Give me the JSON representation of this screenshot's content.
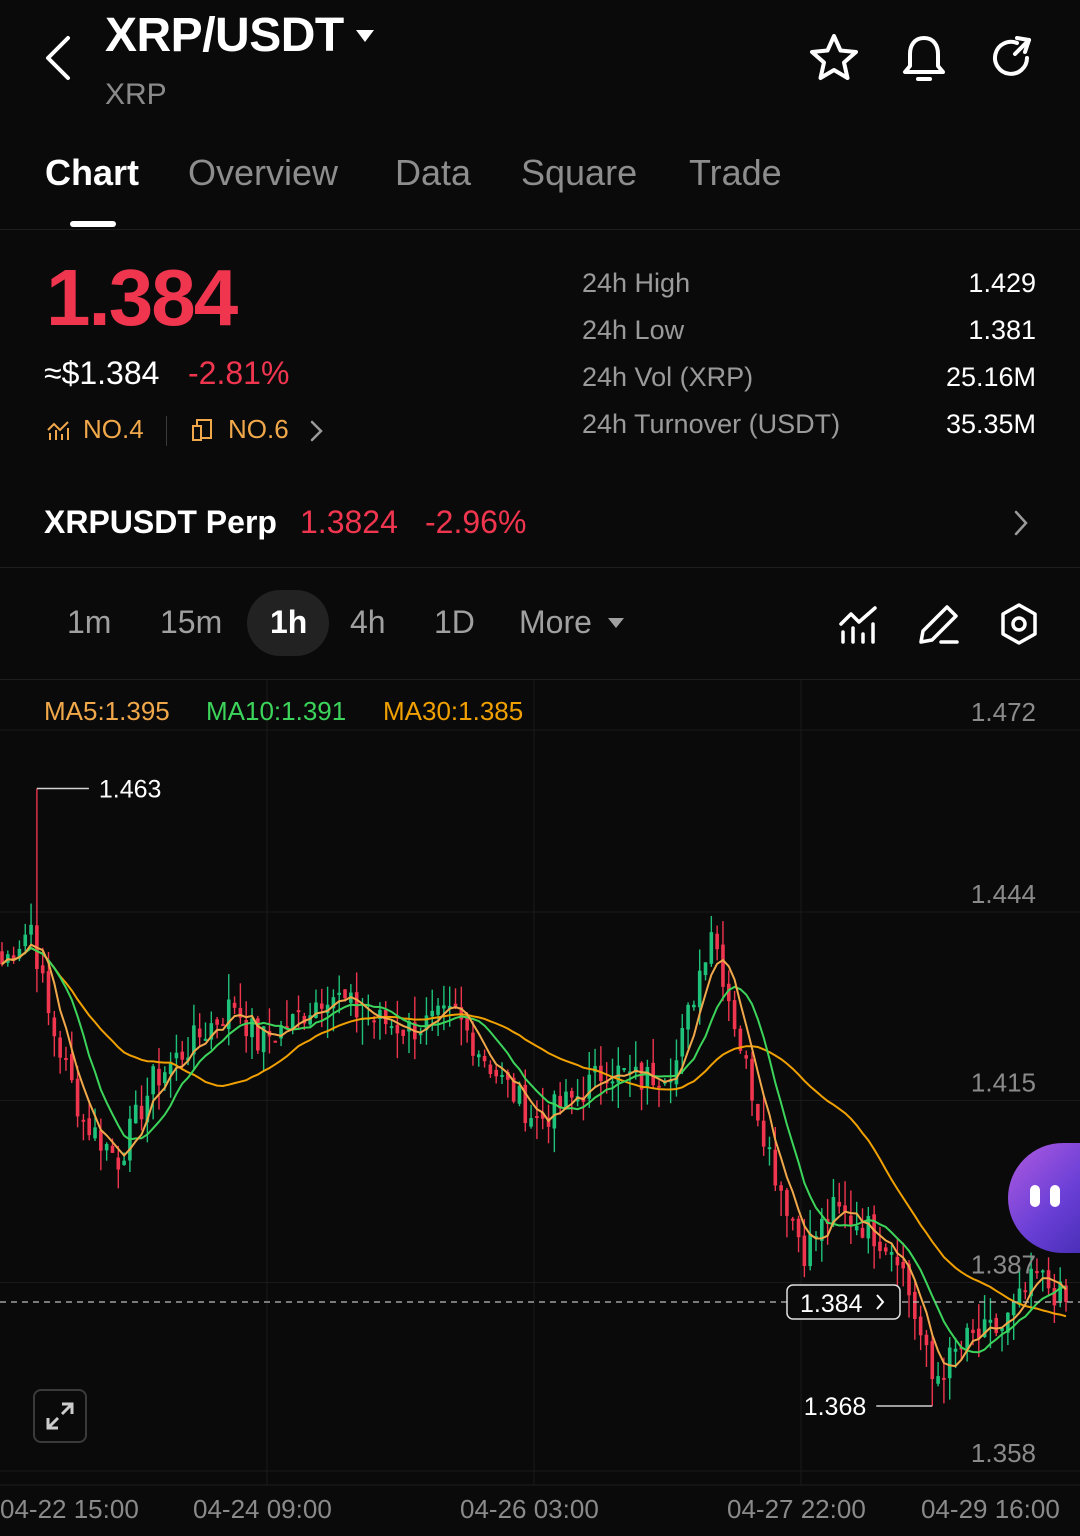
{
  "header": {
    "pair": "XRP/USDT",
    "base": "XRP",
    "icons": [
      "back-arrow-icon",
      "star-icon",
      "bell-icon",
      "share-icon"
    ]
  },
  "tabs": [
    {
      "label": "Chart",
      "active": true
    },
    {
      "label": "Overview",
      "active": false
    },
    {
      "label": "Data",
      "active": false
    },
    {
      "label": "Square",
      "active": false
    },
    {
      "label": "Trade",
      "active": false
    }
  ],
  "price": {
    "last": "1.384",
    "usd": "≈$1.384",
    "change_pct": "-2.81%",
    "rank1": "NO.4",
    "rank2": "NO.6"
  },
  "stats": [
    {
      "label": "24h  High",
      "value": "1.429"
    },
    {
      "label": "24h  Low",
      "value": "1.381"
    },
    {
      "label": "24h  Vol (XRP)",
      "value": "25.16M"
    },
    {
      "label": "24h  Turnover (USDT)",
      "value": "35.35M"
    }
  ],
  "perp": {
    "name": "XRPUSDT Perp",
    "price": "1.3824",
    "change_pct": "-2.96%"
  },
  "timeframes": [
    {
      "label": "1m",
      "active": false
    },
    {
      "label": "15m",
      "active": false
    },
    {
      "label": "1h",
      "active": true
    },
    {
      "label": "4h",
      "active": false
    },
    {
      "label": "1D",
      "active": false
    },
    {
      "label": "More",
      "active": false
    }
  ],
  "ma": {
    "ma5": "MA5:1.395",
    "ma10": "MA10:1.391",
    "ma30": "MA30:1.385"
  },
  "colors": {
    "up": "#1fc27a",
    "down": "#f0354f",
    "ma5": "#f0a84a",
    "ma10": "#3cd45a",
    "ma30": "#f0a000",
    "accent_rank": "#f0a84a"
  },
  "chart_data": {
    "type": "candlestick",
    "y_ticks": [
      "1.472",
      "1.444",
      "1.415",
      "1.387",
      "1.358"
    ],
    "ylim": [
      1.358,
      1.472
    ],
    "x_ticks": [
      "04-22 15:00",
      "04-24 09:00",
      "04-26 03:00",
      "04-27 22:00",
      "04-29 16:00"
    ],
    "high_marker": "1.463",
    "low_marker": "1.368",
    "current_price_tag": "1.384",
    "current_price": 1.384,
    "high_value": 1.463,
    "low_value": 1.368,
    "close_keypoints": [
      [
        0,
        1.436
      ],
      [
        5,
        1.442
      ],
      [
        8,
        1.428
      ],
      [
        14,
        1.412
      ],
      [
        20,
        1.406
      ],
      [
        26,
        1.418
      ],
      [
        34,
        1.425
      ],
      [
        40,
        1.43
      ],
      [
        44,
        1.424
      ],
      [
        50,
        1.427
      ],
      [
        56,
        1.432
      ],
      [
        62,
        1.428
      ],
      [
        70,
        1.426
      ],
      [
        78,
        1.428
      ],
      [
        86,
        1.418
      ],
      [
        92,
        1.412
      ],
      [
        98,
        1.415
      ],
      [
        104,
        1.42
      ],
      [
        110,
        1.418
      ],
      [
        116,
        1.421
      ],
      [
        122,
        1.442
      ],
      [
        128,
        1.42
      ],
      [
        133,
        1.404
      ],
      [
        138,
        1.392
      ],
      [
        143,
        1.398
      ],
      [
        148,
        1.396
      ],
      [
        154,
        1.392
      ],
      [
        160,
        1.372
      ],
      [
        166,
        1.378
      ],
      [
        172,
        1.38
      ],
      [
        178,
        1.388
      ],
      [
        183,
        1.384
      ]
    ]
  }
}
